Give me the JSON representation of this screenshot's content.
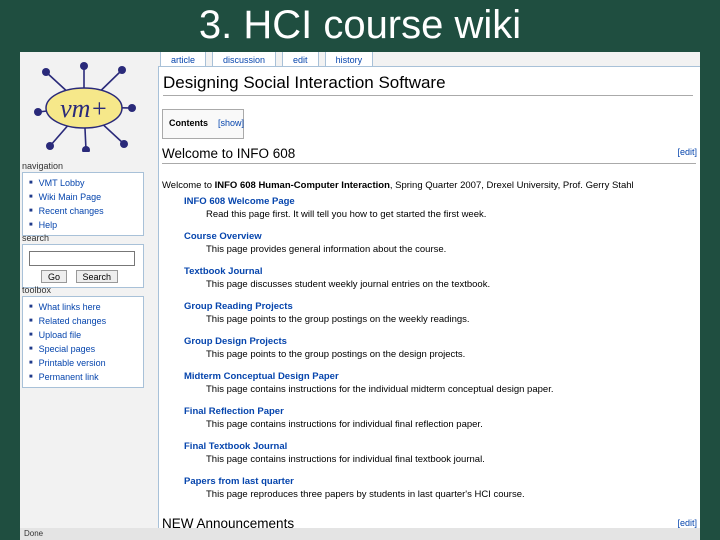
{
  "slide": {
    "title": "3. HCI course wiki"
  },
  "tabs": [
    {
      "label": "article"
    },
    {
      "label": "discussion"
    },
    {
      "label": "edit"
    },
    {
      "label": "history"
    }
  ],
  "logo": {
    "text": "vm+"
  },
  "navigation": {
    "title": "navigation",
    "items": [
      "VMT Lobby",
      "Wiki Main Page",
      "Recent changes",
      "Help"
    ]
  },
  "search": {
    "title": "search",
    "go_label": "Go",
    "search_label": "Search"
  },
  "toolbox": {
    "title": "toolbox",
    "items": [
      "What links here",
      "Related changes",
      "Upload file",
      "Special pages",
      "Printable version",
      "Permanent link"
    ]
  },
  "content": {
    "page_title": "Designing Social Interaction Software",
    "toc_label": "Contents",
    "toc_show": "[show]",
    "welcome_heading": "Welcome to INFO 608",
    "edit_label": "[edit]",
    "intro_prefix": "Welcome to ",
    "intro_bold": "INFO 608 Human-Computer Interaction",
    "intro_suffix": ", Spring Quarter 2007, Drexel University, Prof. Gerry Stahl",
    "links": [
      {
        "title": "INFO 608 Welcome Page",
        "desc": "Read this page first. It will tell you how to get started the first week."
      },
      {
        "title": "Course Overview",
        "desc": "This page provides general information about the course."
      },
      {
        "title": "Textbook Journal",
        "desc": "This page discusses student weekly journal entries on the textbook."
      },
      {
        "title": "Group Reading Projects",
        "desc": "This page points to the group postings on the weekly readings."
      },
      {
        "title": "Group Design Projects",
        "desc": "This page points to the group postings on the design projects."
      },
      {
        "title": "Midterm Conceptual Design Paper",
        "desc": "This page contains instructions for the individual midterm conceptual design paper."
      },
      {
        "title": "Final Reflection Paper",
        "desc": "This page contains instructions for individual final reflection paper."
      },
      {
        "title": "Final Textbook Journal",
        "desc": "This page contains instructions for individual final textbook journal."
      },
      {
        "title": "Papers from last quarter",
        "desc": "This page reproduces three papers by students in last quarter's HCI course."
      }
    ],
    "announcements_heading": "NEW Announcements"
  },
  "status": {
    "text": "Done"
  }
}
